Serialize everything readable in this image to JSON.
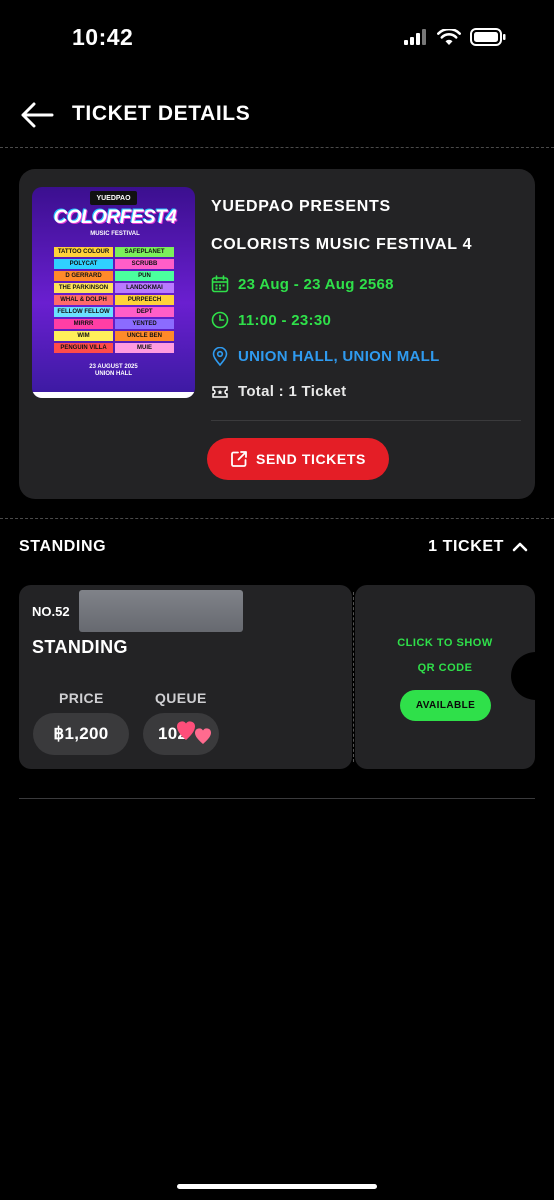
{
  "status_bar": {
    "time": "10:42"
  },
  "header": {
    "title": "TICKET DETAILS"
  },
  "event": {
    "presenter": "YUEDPAO PRESENTS",
    "name": "COLORISTS MUSIC FESTIVAL 4",
    "date": "23 Aug - 23 Aug 2568",
    "time": "11:00 - 23:30",
    "venue": "UNION HALL, UNION MALL",
    "total": "Total : 1 Ticket",
    "send_label": "SEND TICKETS",
    "poster": {
      "publisher": "YUEDPAO",
      "title": "COLORFEST4",
      "subtitle": "MUSIC FESTIVAL",
      "lineup": [
        [
          "TATTOO COLOUR",
          "SAFEPLANET"
        ],
        [
          "POLYCAT",
          "SCRUBB"
        ],
        [
          "D GERRARD",
          "PUN"
        ],
        [
          "THE PARKINSON",
          "LANDOKMAI"
        ],
        [
          "WHAL & DOLPH",
          "PURPEECH"
        ],
        [
          "FELLOW FELLOW",
          "DEPT"
        ],
        [
          "MIRRR",
          "YENTED"
        ],
        [
          "WIM",
          "UNCLE BEN"
        ],
        [
          "PENGUIN VILLA",
          "MUIE"
        ]
      ],
      "date_line": "23 AUGUST 2025",
      "venue_line": "UNION HALL"
    }
  },
  "section": {
    "title": "STANDING",
    "count": "1 TICKET"
  },
  "ticket": {
    "number": "NO.52",
    "type": "STANDING",
    "price_label": "PRICE",
    "price": "฿1,200",
    "queue_label": "QUEUE",
    "queue": "102",
    "qr_line1": "CLICK TO SHOW",
    "qr_line2": "QR CODE",
    "status": "AVAILABLE"
  },
  "colors": {
    "accent_red": "#e41e26",
    "accent_green": "#2fe04a",
    "accent_blue": "#2f9bf0",
    "card": "#232325"
  }
}
